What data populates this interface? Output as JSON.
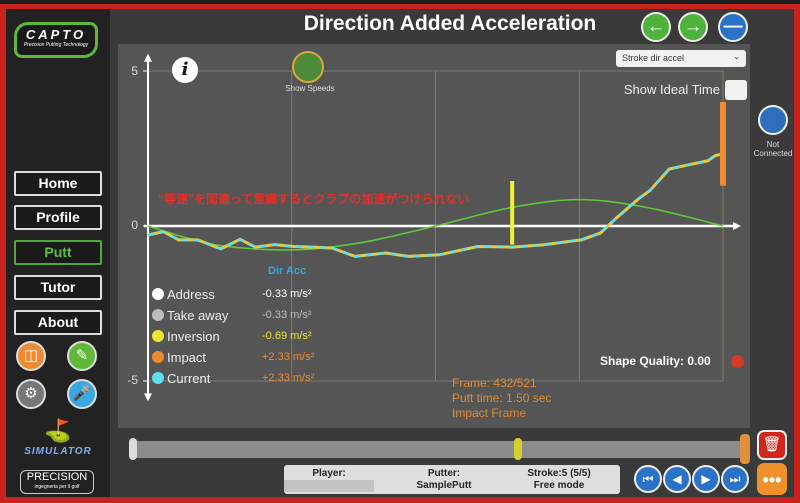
{
  "app": {
    "logo": "CAPTO",
    "logo_sub": "Precision Putting Technology",
    "title": "Direction Added Acceleration"
  },
  "sidebar": {
    "items": [
      {
        "label": "Home"
      },
      {
        "label": "Profile"
      },
      {
        "label": "Putt",
        "active": true
      },
      {
        "label": "Tutor"
      },
      {
        "label": "About"
      }
    ],
    "icons": [
      "book-icon",
      "report-icon",
      "gear-icon",
      "voice-record-icon"
    ],
    "simulator_label": "SIMULATOR",
    "precision_logo": "PRECISION",
    "precision_sub": "ingegneria per il golf"
  },
  "toolbar": {
    "back_icon": "arrow-left-icon",
    "forward_icon": "arrow-right-icon",
    "minus_icon": "minus-icon"
  },
  "chart_controls": {
    "select_value": "Stroke dir accel",
    "show_ideal_time_label": "Show Ideal Time",
    "show_ideal_time_checked": false,
    "show_speeds_label": "Show Speeds"
  },
  "connection": {
    "label": "Not Connected"
  },
  "annotation": "“等速”を間違って意識するとクラブの加速がつけられない",
  "legend": {
    "header": "Dir Acc",
    "rows": [
      {
        "label": "Address",
        "value": "-0.33 m/s²",
        "color": "#ffffff"
      },
      {
        "label": "Take away",
        "value": "-0.33 m/s²",
        "color": "#bdbdbd"
      },
      {
        "label": "Inversion",
        "value": "-0.69 m/s²",
        "color": "#f2e630"
      },
      {
        "label": "Impact",
        "value": "+2.33 m/s²",
        "color": "#f08a30"
      },
      {
        "label": "Current",
        "value": "+2.33 m/s²",
        "color": "#5ee0ee"
      }
    ]
  },
  "frame_info": {
    "frame": "Frame: 432/521",
    "putt_time": "Putt time: 1.50 sec",
    "status": "Impact Frame"
  },
  "shape_quality": {
    "label": "Shape Quality: 0.00",
    "status_color": "#d43a2a"
  },
  "timeline": {
    "position": 0.63
  },
  "info_bar": {
    "player_label": "Player:",
    "player_value": "",
    "putter_label": "Putter:",
    "putter_value": "SamplePutt",
    "stroke_label": "Stroke:5 (5/5)",
    "mode": "Free mode"
  },
  "playback": [
    "skip-start-icon",
    "step-back-icon",
    "step-forward-icon",
    "skip-end-icon"
  ],
  "chart_data": {
    "type": "line",
    "title": "",
    "xlabel": "",
    "ylabel": "",
    "ylim": [
      -5,
      5
    ],
    "yticks": [
      "5",
      "0",
      "-5"
    ],
    "xlim": [
      0,
      1.5
    ],
    "grid": true,
    "series": [
      {
        "role": "ideal",
        "color": "#5cc83a",
        "points": [
          [
            0,
            0
          ],
          [
            0.1,
            -0.38
          ],
          [
            0.2,
            -0.65
          ],
          [
            0.375,
            -0.77
          ],
          [
            0.55,
            -0.55
          ],
          [
            0.75,
            0
          ],
          [
            0.95,
            0.6
          ],
          [
            1.125,
            0.85
          ],
          [
            1.3,
            0.6
          ],
          [
            1.5,
            0
          ]
        ]
      },
      {
        "role": "measured",
        "colors": [
          "#f2c830",
          "#5ee0ee"
        ],
        "points": [
          [
            0,
            -0.29
          ],
          [
            0.04,
            -0.18
          ],
          [
            0.08,
            -0.45
          ],
          [
            0.13,
            -0.45
          ],
          [
            0.19,
            -0.74
          ],
          [
            0.24,
            -0.43
          ],
          [
            0.28,
            -0.68
          ],
          [
            0.33,
            -0.6
          ],
          [
            0.38,
            -0.66
          ],
          [
            0.43,
            -0.68
          ],
          [
            0.48,
            -0.71
          ],
          [
            0.54,
            -0.98
          ],
          [
            0.62,
            -0.87
          ],
          [
            0.68,
            -0.98
          ],
          [
            0.76,
            -0.93
          ],
          [
            0.86,
            -0.66
          ],
          [
            0.95,
            -0.68
          ],
          [
            1.03,
            -0.61
          ],
          [
            1.13,
            -0.45
          ],
          [
            1.18,
            -0.23
          ],
          [
            1.22,
            0.24
          ],
          [
            1.28,
            0.88
          ],
          [
            1.31,
            1.15
          ],
          [
            1.36,
            1.84
          ],
          [
            1.42,
            2.0
          ],
          [
            1.46,
            2.1
          ],
          [
            1.48,
            2.27
          ],
          [
            1.5,
            2.33
          ]
        ]
      }
    ],
    "markers": [
      {
        "name": "inversion",
        "x": 0.95,
        "y_range": [
          -0.6,
          1.45
        ],
        "color": "#f2f030"
      },
      {
        "name": "impact",
        "x": 1.5,
        "y_range": [
          1.3,
          4.0
        ],
        "color": "#f08a30"
      }
    ]
  }
}
